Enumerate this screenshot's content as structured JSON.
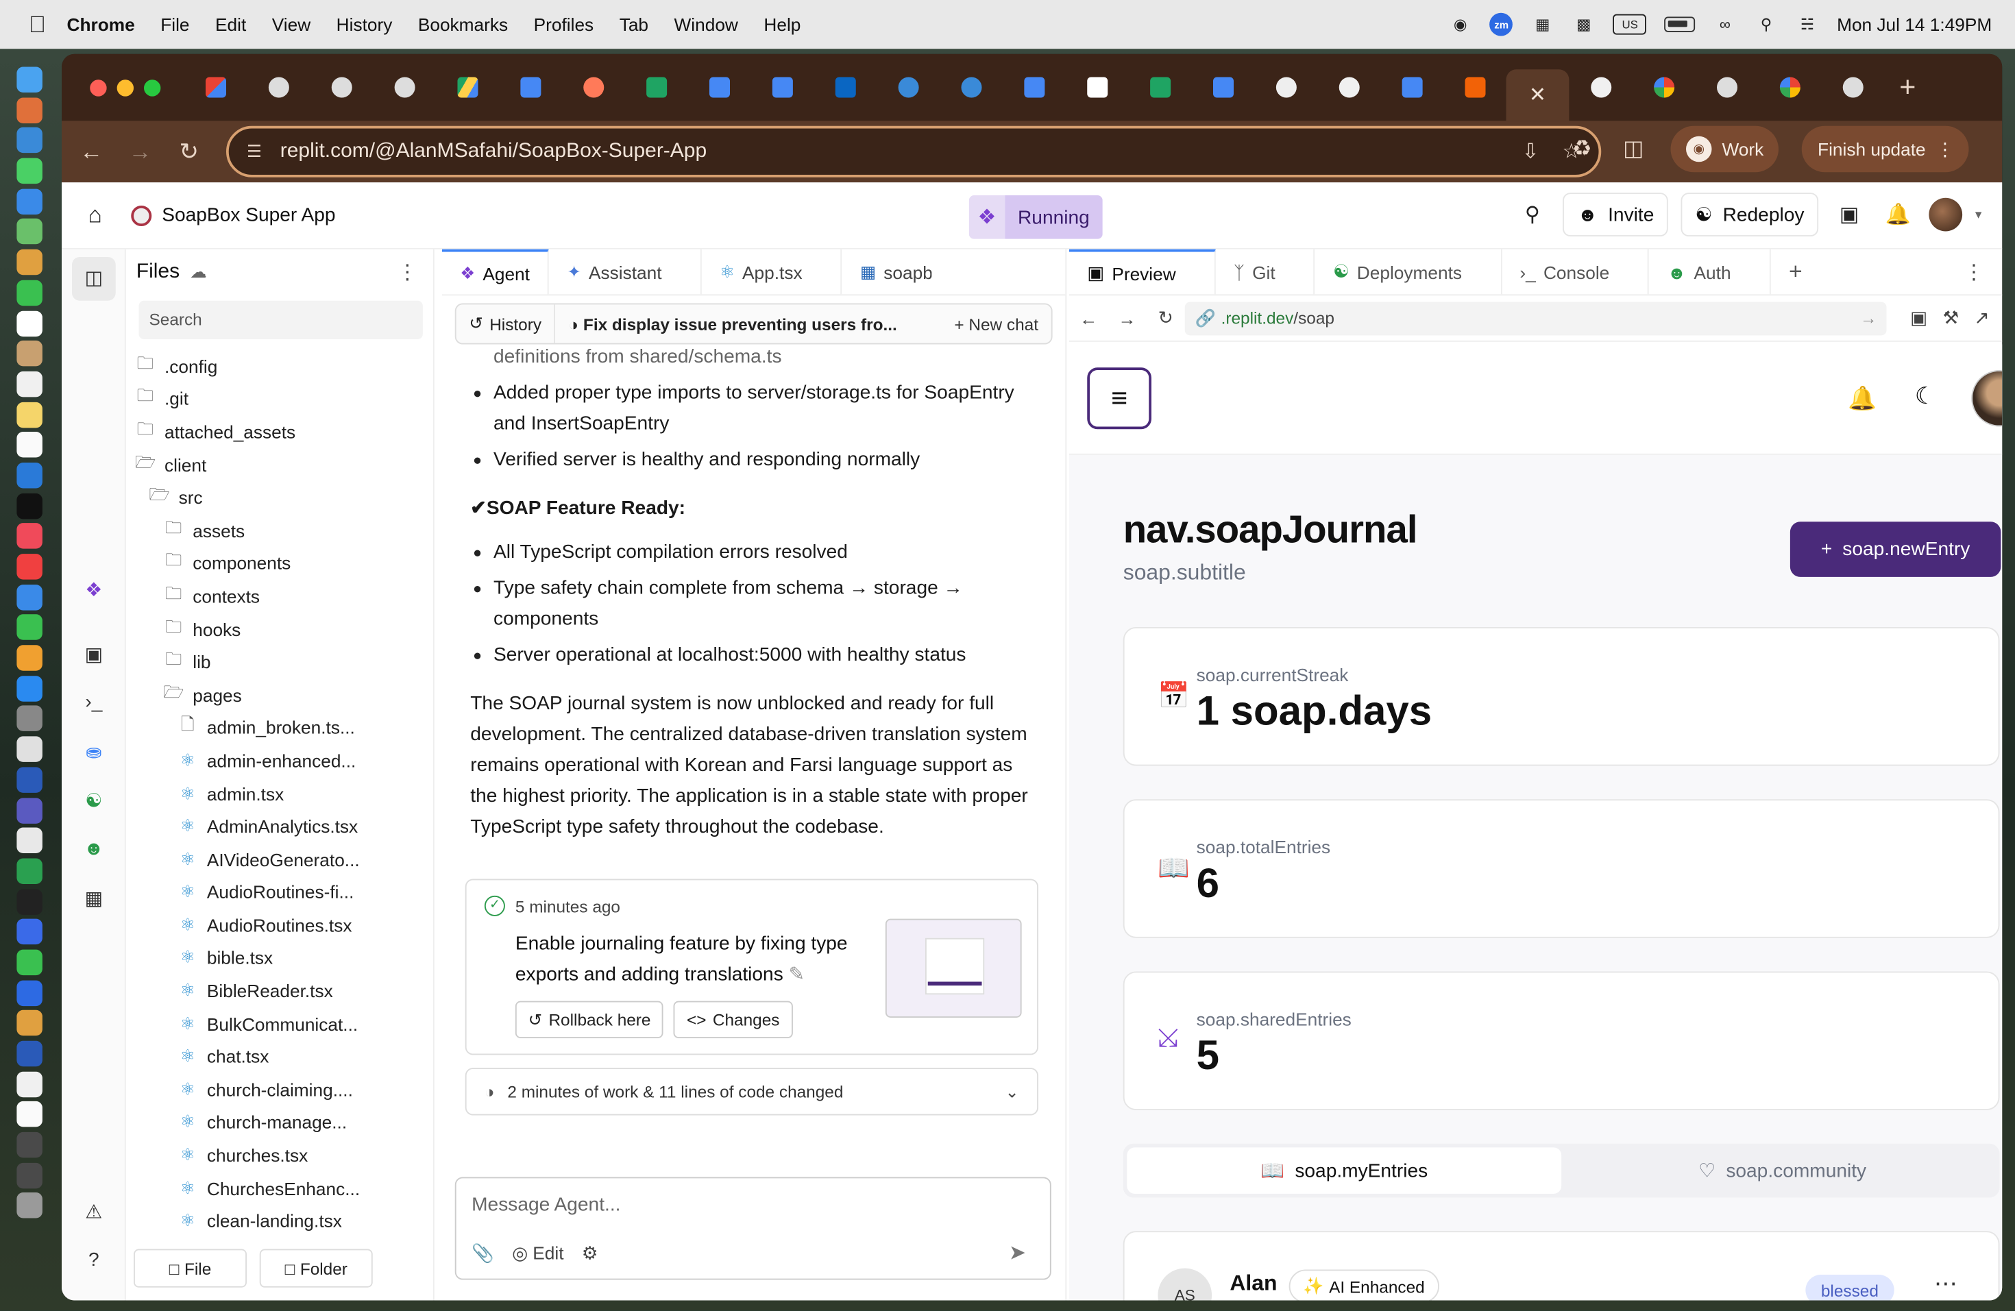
{
  "menubar": {
    "items": [
      "Chrome",
      "File",
      "Edit",
      "View",
      "History",
      "Bookmarks",
      "Profiles",
      "Tab",
      "Window",
      "Help"
    ],
    "zoom_icon": "zm",
    "input_source": "US",
    "datetime": "Mon Jul 14  1:49PM"
  },
  "browser": {
    "url": "replit.com/@AlanMSafahi/SoapBox-Super-App",
    "profile_label": "Work",
    "update_label": "Finish update",
    "tab_favicons": [
      "gmail-icon",
      "globe-icon",
      "globe-icon",
      "globe-icon",
      "drive-icon",
      "docs-icon",
      "hubspot-icon",
      "sheets-icon",
      "docs-icon",
      "docs-icon",
      "linkedin-icon",
      "safari-icon",
      "safari-icon",
      "docs-icon",
      "notion-icon",
      "sheets-icon",
      "docs-icon",
      "openai-icon",
      "github-icon",
      "docs-icon",
      "replit-icon",
      "close-icon",
      "github-icon",
      "google-icon",
      "globe-icon",
      "google-icon",
      "globe-icon"
    ]
  },
  "replit": {
    "app_name": "SoapBox Super App",
    "status": "Running",
    "invite_label": "Invite",
    "redeploy_label": "Redeploy"
  },
  "files": {
    "title": "Files",
    "search_placeholder": "Search",
    "tree": [
      {
        "name": ".config",
        "type": "folder",
        "depth": 0
      },
      {
        "name": ".git",
        "type": "folder",
        "depth": 0
      },
      {
        "name": "attached_assets",
        "type": "folder",
        "depth": 0
      },
      {
        "name": "client",
        "type": "folder-open",
        "depth": 0
      },
      {
        "name": "src",
        "type": "folder-open",
        "depth": 1
      },
      {
        "name": "assets",
        "type": "folder",
        "depth": 2
      },
      {
        "name": "components",
        "type": "folder",
        "depth": 2
      },
      {
        "name": "contexts",
        "type": "folder",
        "depth": 2
      },
      {
        "name": "hooks",
        "type": "folder",
        "depth": 2
      },
      {
        "name": "lib",
        "type": "folder",
        "depth": 2
      },
      {
        "name": "pages",
        "type": "folder-open",
        "depth": 2
      },
      {
        "name": "admin_broken.ts...",
        "type": "file",
        "depth": 3
      },
      {
        "name": "admin-enhanced...",
        "type": "react",
        "depth": 3
      },
      {
        "name": "admin.tsx",
        "type": "react",
        "depth": 3
      },
      {
        "name": "AdminAnalytics.tsx",
        "type": "react",
        "depth": 3
      },
      {
        "name": "AIVideoGenerato...",
        "type": "react",
        "depth": 3
      },
      {
        "name": "AudioRoutines-fi...",
        "type": "react",
        "depth": 3
      },
      {
        "name": "AudioRoutines.tsx",
        "type": "react",
        "depth": 3
      },
      {
        "name": "bible.tsx",
        "type": "react",
        "depth": 3
      },
      {
        "name": "BibleReader.tsx",
        "type": "react",
        "depth": 3
      },
      {
        "name": "BulkCommunicat...",
        "type": "react",
        "depth": 3
      },
      {
        "name": "chat.tsx",
        "type": "react",
        "depth": 3
      },
      {
        "name": "church-claiming....",
        "type": "react",
        "depth": 3
      },
      {
        "name": "church-manage...",
        "type": "react",
        "depth": 3
      },
      {
        "name": "churches.tsx",
        "type": "react",
        "depth": 3
      },
      {
        "name": "ChurchesEnhanc...",
        "type": "react",
        "depth": 3
      },
      {
        "name": "clean-landing.tsx",
        "type": "react",
        "depth": 3
      }
    ],
    "new_file_label": "File",
    "new_folder_label": "Folder"
  },
  "agent": {
    "tabs": [
      "Agent",
      "Assistant",
      "App.tsx",
      "soapb"
    ],
    "history_label": "History",
    "chat_title": "Fix display issue preventing users fro...",
    "new_chat_label": "New chat",
    "clipped_line": "definitions from shared/schema.ts",
    "bullets1": [
      "Added proper type imports to server/storage.ts for SoapEntry and InsertSoapEntry",
      "Verified server is healthy and responding normally"
    ],
    "heading": "✔SOAP Feature Ready:",
    "bullets2": [
      "All TypeScript compilation errors resolved",
      "Type safety chain complete from schema → storage → components",
      "Server operational at localhost:5000 with healthy status"
    ],
    "summary": "The SOAP journal system is now unblocked and ready for full development. The centralized database-driven translation system remains operational with Korean and Farsi language support as the highest priority. The application is in a stable state with proper TypeScript type safety throughout the codebase.",
    "checkpoint": {
      "time": "5 minutes ago",
      "message": "Enable journaling feature by fixing type exports and adding translations",
      "rollback_label": "Rollback here",
      "changes_label": "Changes"
    },
    "work_summary": "2 minutes of work & 11 lines of code changed",
    "input_placeholder": "Message Agent...",
    "edit_label": "Edit"
  },
  "preview": {
    "tabs": [
      "Preview",
      "Git",
      "Deployments",
      "Console",
      "Auth"
    ],
    "url_prefix": ".replit.dev",
    "url_path": "/soap",
    "page_title": "nav.soapJournal",
    "page_subtitle": "soap.subtitle",
    "new_entry_label": "soap.newEntry",
    "stats": [
      {
        "label": "soap.currentStreak",
        "value": "1 soap.days",
        "icon": "calendar-icon"
      },
      {
        "label": "soap.totalEntries",
        "value": "6",
        "icon": "book-icon"
      },
      {
        "label": "soap.sharedEntries",
        "value": "5",
        "icon": "share-icon"
      }
    ],
    "tab_my_entries": "soap.myEntries",
    "tab_community": "soap.community",
    "entry": {
      "avatar_initials": "AS",
      "author": "Alan",
      "badge": "AI Enhanced",
      "mood": "blessed"
    }
  },
  "colors": {
    "accent": "#4a2a7a",
    "browser_frame": "#5a3a28",
    "running_bg": "#d7c7f2"
  }
}
